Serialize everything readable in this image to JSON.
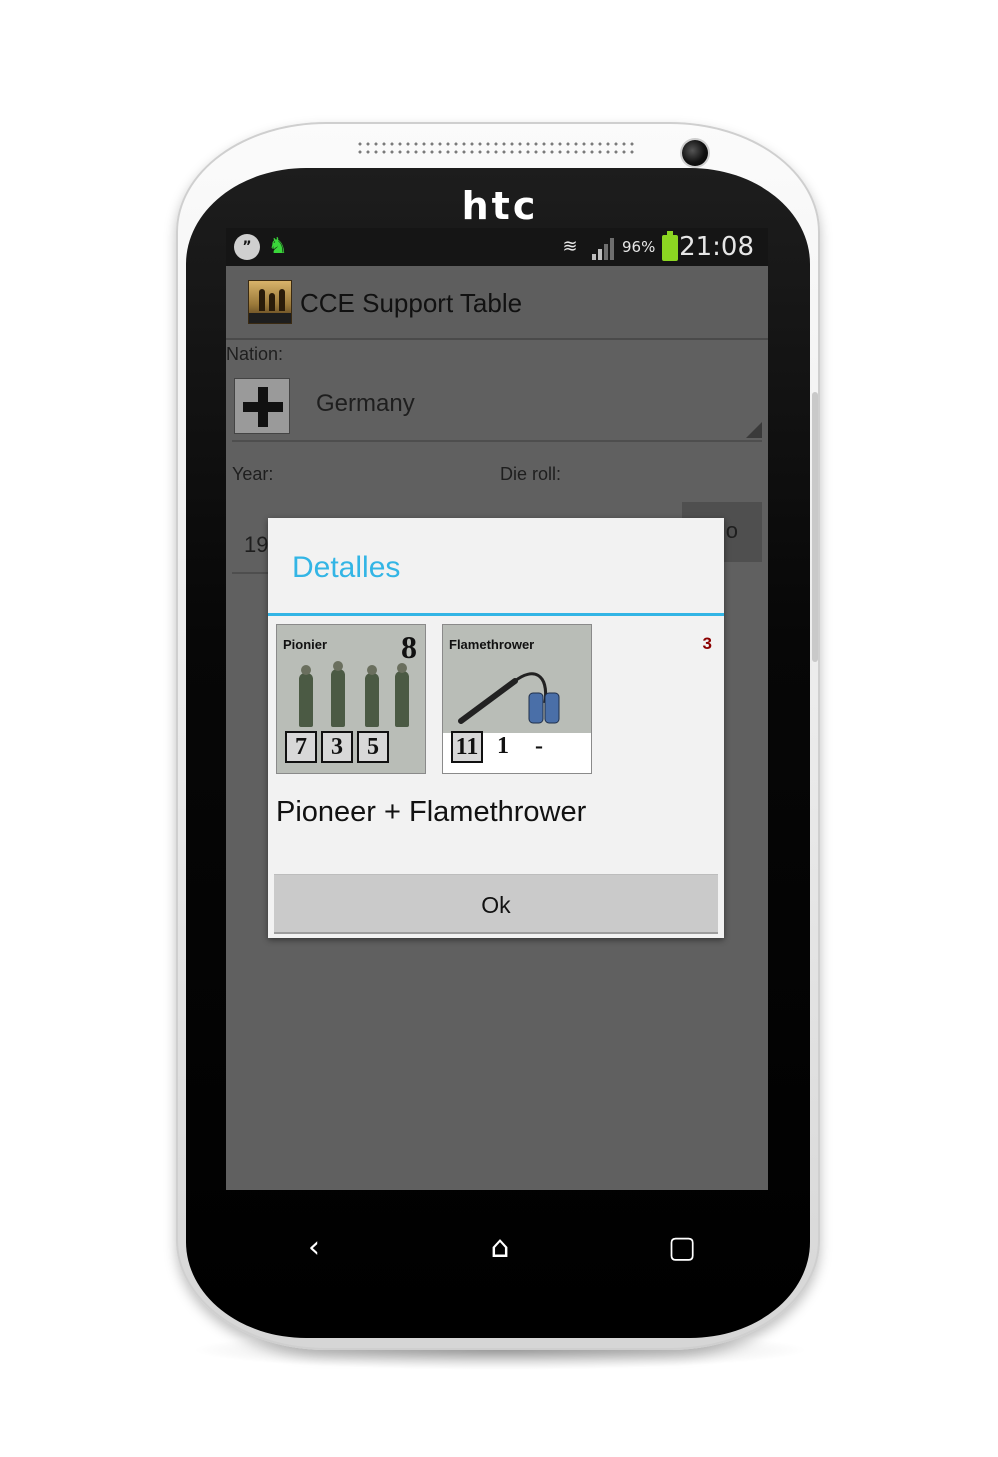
{
  "device": {
    "brand": "htc"
  },
  "status_bar": {
    "left_icons": [
      "hangouts-icon",
      "app-notification-icon"
    ],
    "battery_percent": "96%",
    "time": "21:08"
  },
  "app": {
    "title": "CCE Support Table"
  },
  "form": {
    "nation_label": "Nation:",
    "nation_value": "Germany",
    "year_label": "Year:",
    "die_roll_label": "Die roll:",
    "year_value_partial": "19",
    "roll_button_partial": "o"
  },
  "dialog": {
    "title": "Detalles",
    "count": "3",
    "counters": [
      {
        "name": "Pionier",
        "morale": "8",
        "stats": [
          "7",
          "3",
          "5"
        ]
      },
      {
        "name": "Flamethrower",
        "stats": [
          "11",
          "1",
          "-"
        ]
      }
    ],
    "message": "Pioneer + Flamethrower",
    "ok_label": "Ok"
  },
  "nav": {
    "back_glyph": "‹",
    "home_glyph": "⌂",
    "recents_glyph": "▢"
  },
  "colors": {
    "accent": "#33b5e5",
    "count_color": "#8b0000",
    "battery": "#8cd622"
  }
}
